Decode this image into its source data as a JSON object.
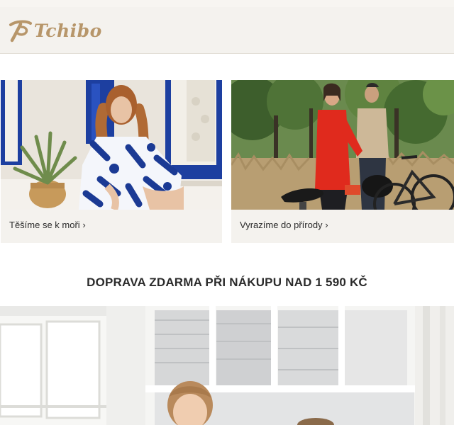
{
  "header": {
    "logo_text": "Tchibo",
    "brand_color": "#b7966a"
  },
  "teasers": [
    {
      "caption": "Těšíme se k moři",
      "chevron": "›",
      "image": "woman in blue patterned dress by window"
    },
    {
      "caption": "Vyrazíme do přírody",
      "chevron": "›",
      "image": "couple with bicycles in nature"
    }
  ],
  "promo": {
    "text": "DOPRAVA ZDARMA PŘI NÁKUPU NAD 1 590 KČ"
  },
  "hero": {
    "image": "child in white room with large windows"
  },
  "colors": {
    "header_bg": "#f4f2ee",
    "card_bg": "#f4f2ee",
    "text": "#2b2b2b",
    "blue_shutter": "#1d3fa0",
    "red_jacket": "#e02a1d"
  }
}
